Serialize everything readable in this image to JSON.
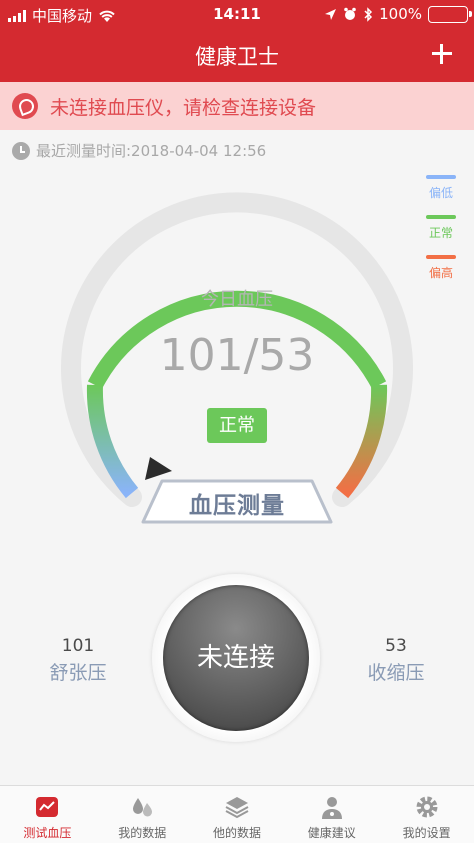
{
  "status_bar": {
    "carrier": "中国移动",
    "time": "14:11",
    "battery": "100%"
  },
  "nav": {
    "title": "健康卫士",
    "add_label": "+"
  },
  "alert": {
    "message": "未连接血压仪，请检查连接设备"
  },
  "last_measure": {
    "label": "最近测量时间:2018-04-04 12:56"
  },
  "legend": {
    "items": [
      {
        "label": "偏低",
        "color": "#8ab4f8"
      },
      {
        "label": "正常",
        "color": "#6cc85a"
      },
      {
        "label": "偏高",
        "color": "#f26f45"
      }
    ]
  },
  "gauge": {
    "today_label": "今日血压",
    "value": "101/53",
    "status": "正常",
    "measure_button": "血压测量"
  },
  "readings": {
    "diastolic_value": "101",
    "diastolic_label": "舒张压",
    "systolic_value": "53",
    "systolic_label": "收缩压"
  },
  "connect": {
    "label": "未连接"
  },
  "tabs": [
    {
      "label": "测试血压",
      "icon": "chart-icon",
      "active": true
    },
    {
      "label": "我的数据",
      "icon": "drops-icon",
      "active": false
    },
    {
      "label": "他的数据",
      "icon": "layers-icon",
      "active": false
    },
    {
      "label": "健康建议",
      "icon": "doctor-icon",
      "active": false
    },
    {
      "label": "我的设置",
      "icon": "gear-icon",
      "active": false
    }
  ],
  "colors": {
    "brand": "#d42a30",
    "normal": "#6cc85a",
    "low": "#8ab4f8",
    "high": "#f26f45"
  }
}
